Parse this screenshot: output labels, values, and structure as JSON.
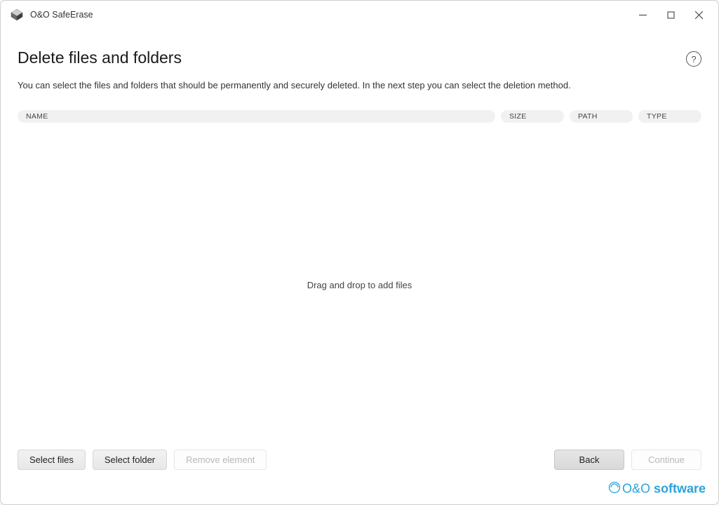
{
  "window": {
    "app_title": "O&O SafeErase"
  },
  "page": {
    "title": "Delete files and folders",
    "description": "You can select the files and folders that should be permanently and securely deleted. In the next step you can select the deletion method."
  },
  "columns": {
    "name": "NAME",
    "size": "SIZE",
    "path": "PATH",
    "type": "TYPE"
  },
  "drop_area": {
    "hint": "Drag and drop to add files"
  },
  "buttons": {
    "select_files": "Select files",
    "select_folder": "Select folder",
    "remove_element": "Remove element",
    "back": "Back",
    "continue": "Continue"
  },
  "help": {
    "label": "?"
  },
  "branding": {
    "text_part1": "O&O ",
    "text_part2": "software"
  }
}
